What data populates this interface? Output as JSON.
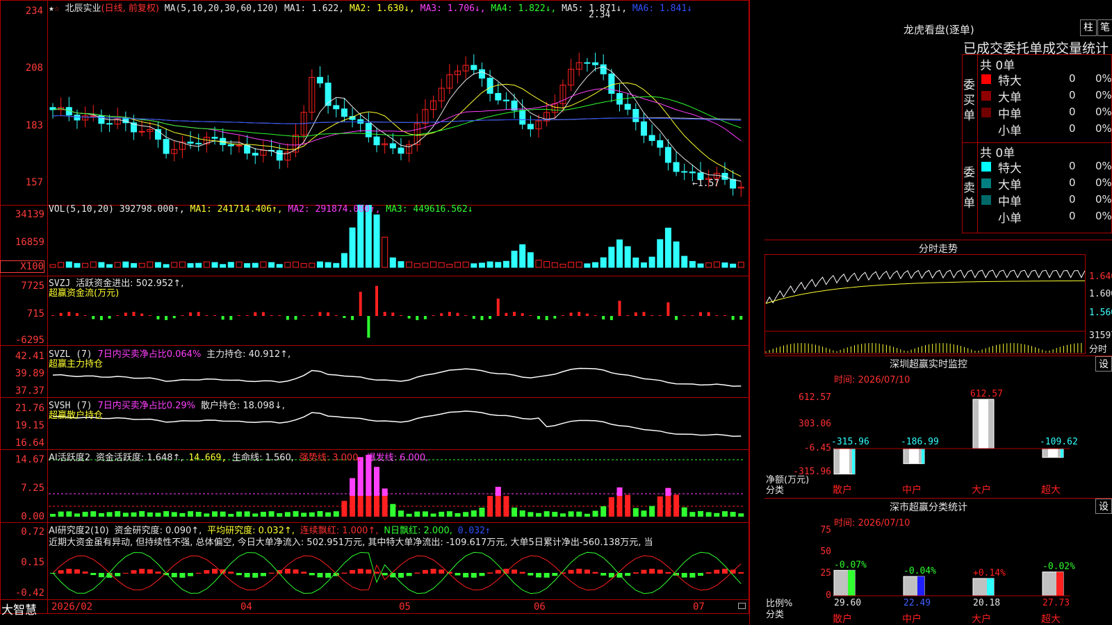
{
  "colors": {
    "up": "#ff2020",
    "down": "#30ffff",
    "ma1": "#e8e8e8",
    "ma2": "#ffff30",
    "ma3": "#ff40ff",
    "ma4": "#30ff30",
    "ma5": "#3050ff",
    "ma6": "#c0c0c0",
    "grid": "#b00000"
  },
  "header": {
    "title": "北辰实业",
    "mode": "(日线, 前复权)",
    "ma_params": "MA(5,10,20,30,60,120)",
    "ma": [
      {
        "label": "MA1: 1.622,",
        "color": "#e8e8e8"
      },
      {
        "label": "MA2: 1.630↓,",
        "color": "#ffff30"
      },
      {
        "label": "MA3: 1.706↓,",
        "color": "#ff40ff"
      },
      {
        "label": "MA4: 1.822↓,",
        "color": "#30ff30"
      },
      {
        "label": "MA5: 1.871↓,",
        "color": "#e8e8e8"
      },
      {
        "label": "MA6: 1.841↓",
        "color": "#3050ff"
      }
    ],
    "high_label": "2.34",
    "low_label": "←1.57"
  },
  "price_axis": [
    "234",
    "208",
    "183",
    "157"
  ],
  "vol": {
    "title": "VOL(5,10,20)",
    "value": "392798.000↑,",
    "ma1": "MA1: 241714.406↑,",
    "ma2": "MA2: 291874.000↑,",
    "ma3": "MA3: 449616.562↓",
    "axis": [
      "34139",
      "16859",
      "X100"
    ]
  },
  "svzj": {
    "title": "SVZJ",
    "l1": "活跃资金进出: 502.952↑,",
    "l2": "超赢资金流(万元)",
    "axis": [
      "7725",
      "715",
      "-6295"
    ]
  },
  "svzl": {
    "title": "SVZL (7)",
    "l1": "7日内买卖净占比0.064%",
    "l2": "主力持仓: 40.912↑,",
    "l3": "超赢主力持仓",
    "axis": [
      "42.41",
      "39.89",
      "37.37"
    ]
  },
  "svsh": {
    "title": "SVSH (7)",
    "l1": "7日内买卖净占比0.29%",
    "l2": "散户持仓: 18.098↓,",
    "l3": "超赢散户持仓",
    "axis": [
      "21.76",
      "19.15",
      "16.64"
    ]
  },
  "ai1": {
    "title": "AI活跃度2",
    "l1": "资金活跃度: 1.648↑,",
    "l2": "14.669,",
    "l3": "生命线: 1.560,",
    "l4": "强势线: 3.000,",
    "l5": "爆发线: 6.000,",
    "axis": [
      "14.67",
      "7.25",
      "0.00"
    ]
  },
  "ai2": {
    "title": "AI研究度2(10)",
    "l1": "资金研究度: 0.090↑,",
    "l2": "平均研究度: 0.032↑,",
    "l3": "连续飘红: 1.000↑,",
    "l4": "N日飘红: 2.000,",
    "l5": "0.032↑",
    "desc": "近期大资金虽有异动, 但持续性不强, 总体偏空, 今日大单净流入: 502.951万元, 其中特大单净流出: -109.617万元, 大单5日累计净出-560.138万元, 当",
    "axis": [
      "0.72",
      "0.15",
      "-0.42"
    ]
  },
  "bottom": {
    "brand": "大智慧",
    "dates": [
      "2026/02",
      "04",
      "05",
      "06",
      "07"
    ]
  },
  "right": {
    "lhb_title": "龙虎看盘(逐单)",
    "btn1": "柱",
    "btn2": "笔",
    "stats_title": "已成交委托单成交量统计",
    "buy": {
      "side": "委买单",
      "total": "共 0单",
      "rows": [
        {
          "name": "特大",
          "v": "0",
          "p": "0%",
          "color": "#ff0000"
        },
        {
          "name": "大单",
          "v": "0",
          "p": "0%",
          "color": "#900000"
        },
        {
          "name": "中单",
          "v": "0",
          "p": "0%",
          "color": "#700000"
        },
        {
          "name": "小单",
          "v": "0",
          "p": "0%",
          "color": ""
        }
      ]
    },
    "sell": {
      "side": "委卖单",
      "total": "共 0单",
      "rows": [
        {
          "name": "特大",
          "v": "0",
          "p": "0%",
          "color": "#00ffff"
        },
        {
          "name": "大单",
          "v": "0",
          "p": "0%",
          "color": "#008080"
        },
        {
          "name": "中单",
          "v": "0",
          "p": "0%",
          "color": "#006868"
        },
        {
          "name": "小单",
          "v": "0",
          "p": "0%",
          "color": ""
        }
      ]
    },
    "trend_title": "分时走势",
    "trend_axis": [
      "1.640",
      "1.600",
      "1.560"
    ],
    "trend_vol": "31597",
    "trend_vol_label": "分时",
    "sz_title": "深圳超赢实时监控",
    "sz_set": "设",
    "sz_time": "时间: 2026/07/10",
    "sz_axis": [
      "612.57",
      "303.06",
      "-6.45",
      "-315.96"
    ],
    "sz_ylabel": "净额(万元)",
    "sz_xlabel": "分类",
    "sz_bars": [
      {
        "cat": "散户",
        "val": "-315.96"
      },
      {
        "cat": "中户",
        "val": "-186.99"
      },
      {
        "cat": "大户",
        "val": "612.57"
      },
      {
        "cat": "超大",
        "val": "-109.62"
      }
    ],
    "cls_title": "深市超赢分类统计",
    "cls_set": "设",
    "cls_time": "时间: 2026/07/10",
    "cls_axis": [
      "75",
      "50",
      "25",
      "0"
    ],
    "cls_ylabel": "比例%",
    "cls_xlabel": "分类",
    "cls_bars": [
      {
        "cat": "散户",
        "pct": "-0.07%",
        "val": "29.60"
      },
      {
        "cat": "中户",
        "pct": "-0.04%",
        "val": "22.49"
      },
      {
        "cat": "大户",
        "pct": "+0.14%",
        "val": "20.18"
      },
      {
        "cat": "超大",
        "pct": "-0.02%",
        "val": "27.73"
      }
    ]
  }
}
